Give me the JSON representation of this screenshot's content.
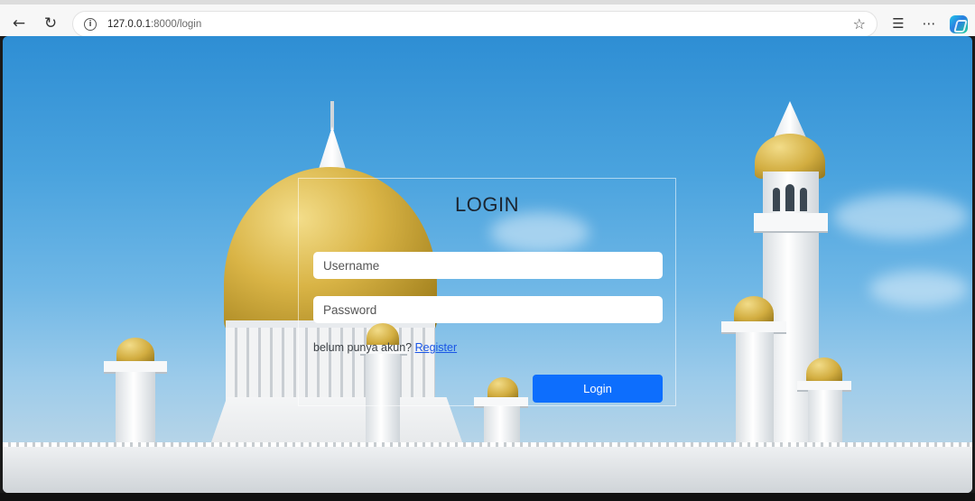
{
  "browser": {
    "url_host": "127.0.0.1",
    "url_path": ":8000/login",
    "icons": {
      "back": "back-arrow-icon",
      "reload": "reload-icon",
      "site_info": "info-icon",
      "favorite": "star-icon",
      "favorites_list": "favorites-list-icon",
      "more": "more-options-icon",
      "copilot": "copilot-icon"
    }
  },
  "login": {
    "title": "LOGIN",
    "username_placeholder": "Username",
    "password_placeholder": "Password",
    "register_prompt": "belum punya akun?",
    "register_link": "Register",
    "submit_label": "Login"
  },
  "colors": {
    "button": "#0d6efd",
    "link": "#1a56e6",
    "sky": "#4aa3de",
    "gold": "#d9b446"
  }
}
